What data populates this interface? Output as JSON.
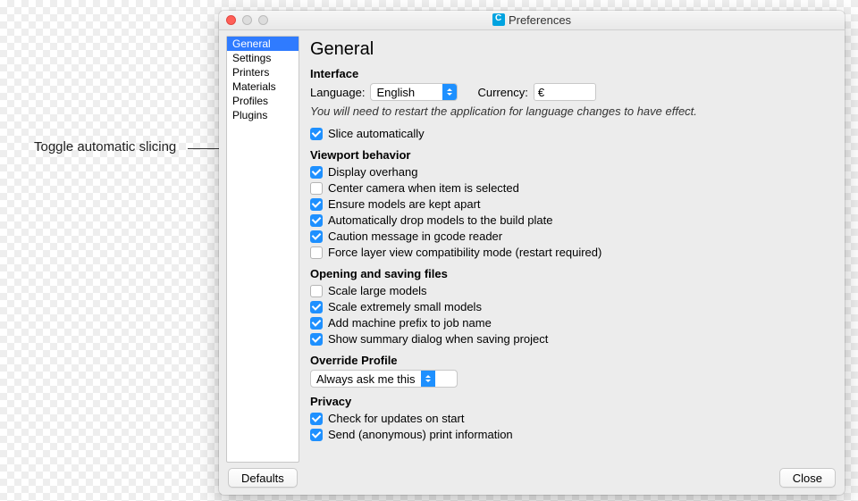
{
  "annotation": "Toggle automatic slicing",
  "window": {
    "title": "Preferences"
  },
  "sidebar": {
    "items": [
      {
        "label": "General",
        "selected": true
      },
      {
        "label": "Settings"
      },
      {
        "label": "Printers"
      },
      {
        "label": "Materials"
      },
      {
        "label": "Profiles"
      },
      {
        "label": "Plugins"
      }
    ]
  },
  "page": {
    "title": "General",
    "interface": {
      "heading": "Interface",
      "language_label": "Language:",
      "language_value": "English",
      "currency_label": "Currency:",
      "currency_value": "€",
      "restart_note": "You will need to restart the application for language changes to have effect."
    },
    "slice_auto": {
      "label": "Slice automatically",
      "checked": true
    },
    "viewport": {
      "heading": "Viewport behavior",
      "items": [
        {
          "label": "Display overhang",
          "checked": true
        },
        {
          "label": "Center camera when item is selected",
          "checked": false
        },
        {
          "label": "Ensure models are kept apart",
          "checked": true
        },
        {
          "label": "Automatically drop models to the build plate",
          "checked": true
        },
        {
          "label": "Caution message in gcode reader",
          "checked": true
        },
        {
          "label": "Force layer view compatibility mode (restart required)",
          "checked": false
        }
      ]
    },
    "files": {
      "heading": "Opening and saving files",
      "items": [
        {
          "label": "Scale large models",
          "checked": false
        },
        {
          "label": "Scale extremely small models",
          "checked": true
        },
        {
          "label": "Add machine prefix to job name",
          "checked": true
        },
        {
          "label": "Show summary dialog when saving project",
          "checked": true
        }
      ]
    },
    "override": {
      "heading": "Override Profile",
      "value": "Always ask me this"
    },
    "privacy": {
      "heading": "Privacy",
      "items": [
        {
          "label": "Check for updates on start",
          "checked": true
        },
        {
          "label": "Send (anonymous) print information",
          "checked": true
        }
      ]
    }
  },
  "buttons": {
    "defaults": "Defaults",
    "close": "Close"
  }
}
